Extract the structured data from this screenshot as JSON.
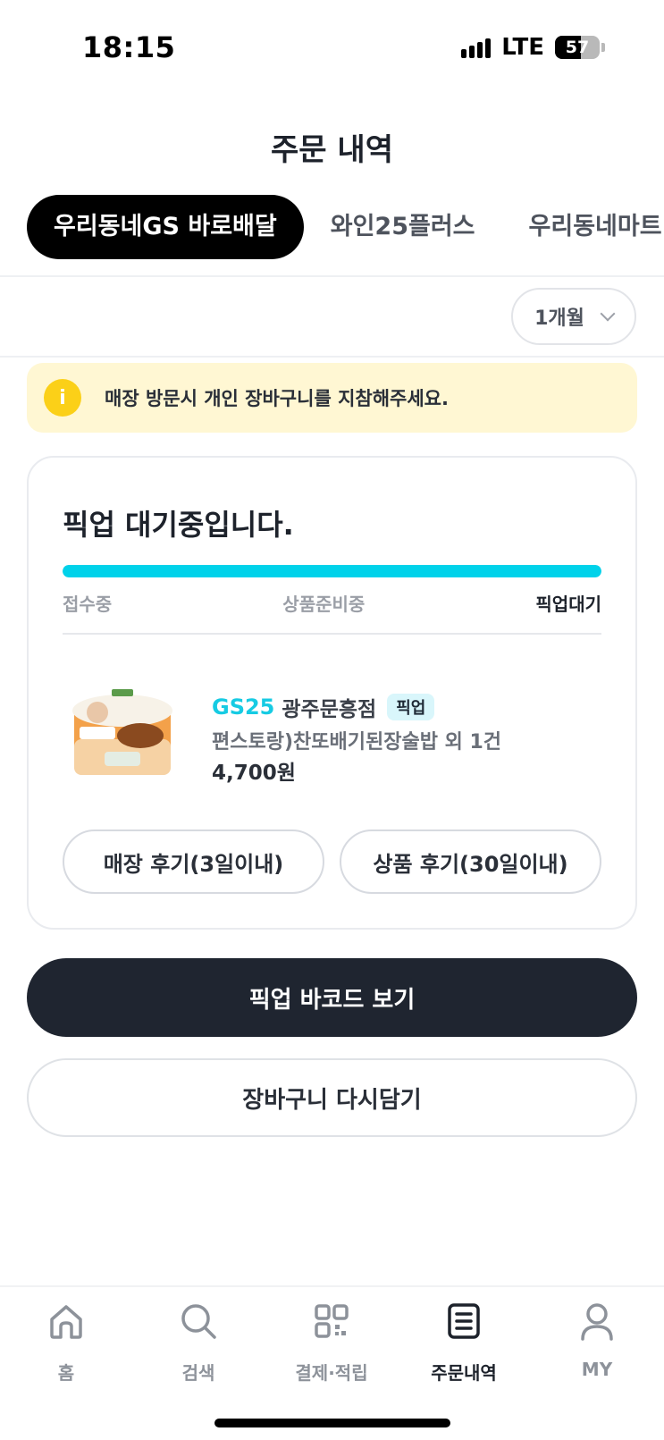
{
  "status_bar": {
    "time": "18:15",
    "network": "LTE",
    "battery": "57"
  },
  "page_title": "주문 내역",
  "tabs": [
    {
      "label": "우리동네GS 바로배달",
      "active": true
    },
    {
      "label": "와인25플러스",
      "active": false
    },
    {
      "label": "우리동네마트 시",
      "active": false
    }
  ],
  "period_filter": {
    "selected": "1개월"
  },
  "notice": {
    "icon": "i",
    "text": "매장 방문시 개인 장바구니를 지참해주세요."
  },
  "order": {
    "status_title": "픽업 대기중입니다.",
    "progress": 1.0,
    "steps": [
      "접수중",
      "상품준비중",
      "픽업대기"
    ],
    "current_step": 2,
    "brand": "GS25",
    "store": "광주문흥점",
    "badge": "픽업",
    "product_name": "편스토랑)찬또배기된장술밥  외 1건",
    "price": "4,700원",
    "store_review_label": "매장 후기(3일이내)",
    "product_review_label": "상품 후기(30일이내)"
  },
  "actions": {
    "barcode_label": "픽업 바코드 보기",
    "recart_label": "장바구니 다시담기"
  },
  "bottom_nav": [
    {
      "label": "홈",
      "icon": "home-icon",
      "active": false
    },
    {
      "label": "검색",
      "icon": "search-icon",
      "active": false
    },
    {
      "label": "결제·적립",
      "icon": "payment-icon",
      "active": false
    },
    {
      "label": "주문내역",
      "icon": "order-history-icon",
      "active": true
    },
    {
      "label": "MY",
      "icon": "profile-icon",
      "active": false
    }
  ],
  "colors": {
    "accent": "#00d2ea",
    "primary_button": "#1f2530",
    "notice_bg": "#fff7d3",
    "notice_icon": "#fbd018"
  }
}
